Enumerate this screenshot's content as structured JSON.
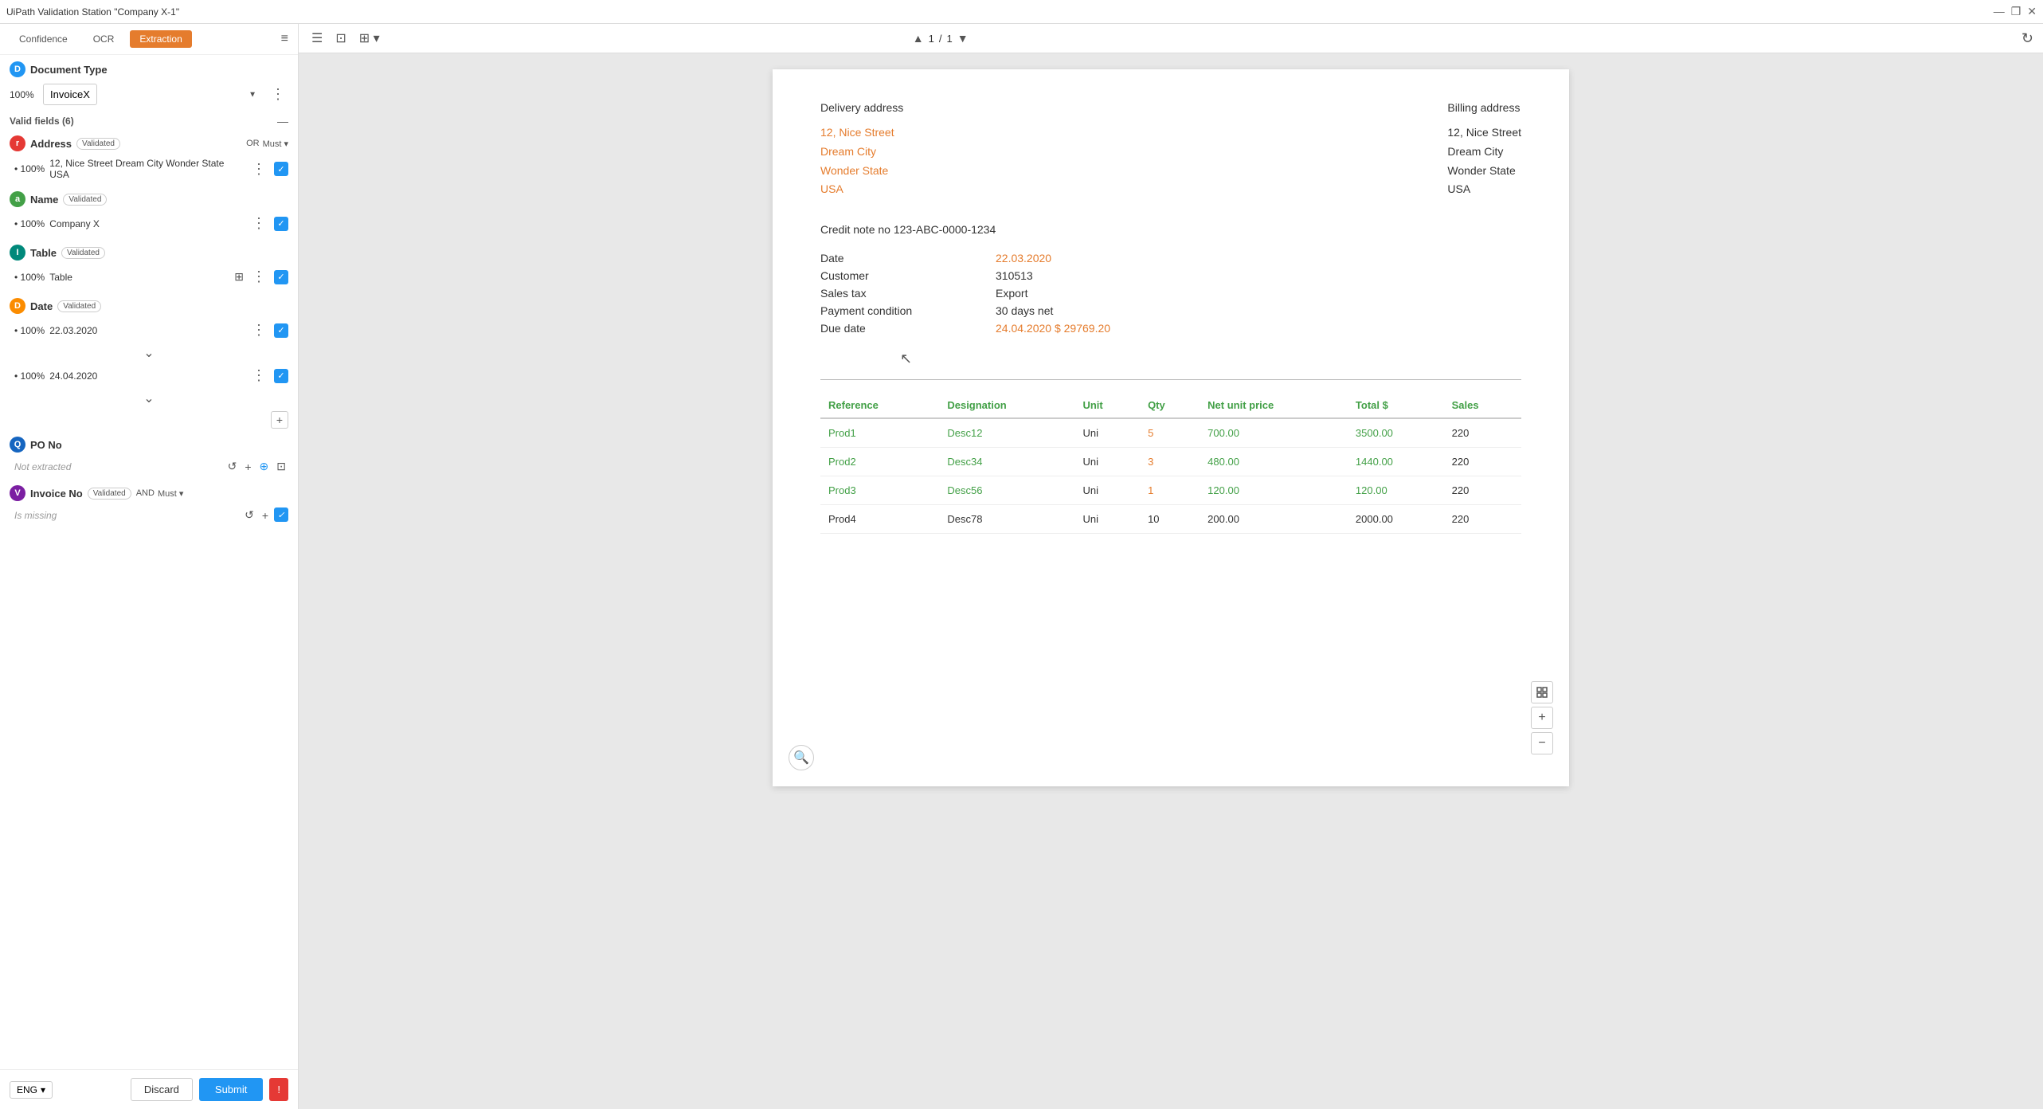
{
  "titlebar": {
    "title": "UiPath Validation Station \"Company X-1\"",
    "controls": [
      "—",
      "❐",
      "✕"
    ]
  },
  "tabs": {
    "confidence_label": "Confidence",
    "ocr_label": "OCR",
    "extraction_label": "Extraction",
    "active": "Extraction"
  },
  "toolbar_filter": "≡",
  "document_type": {
    "label": "Document Type",
    "confidence": "100%",
    "value": "InvoiceX",
    "more_icon": "⋮"
  },
  "valid_fields": {
    "label": "Valid fields (6)",
    "collapse_icon": "—"
  },
  "fields": [
    {
      "id": "address",
      "icon_letter": "r",
      "icon_class": "icon-red",
      "name": "Address",
      "badge": "Validated",
      "logic": "OR",
      "must": "Must",
      "confidence": "100%",
      "value": "12, Nice Street Dream City Wonder State USA",
      "checked": true
    },
    {
      "id": "name",
      "icon_letter": "a",
      "icon_class": "icon-green",
      "name": "Name",
      "badge": "Validated",
      "logic": "",
      "must": "",
      "confidence": "100%",
      "value": "Company X",
      "checked": true
    },
    {
      "id": "table",
      "icon_letter": "I",
      "icon_class": "icon-teal",
      "name": "Table",
      "badge": "Validated",
      "logic": "",
      "must": "",
      "confidence": "100%",
      "value": "Table",
      "is_table": true,
      "checked": true
    },
    {
      "id": "date",
      "icon_letter": "D",
      "icon_class": "icon-orange",
      "name": "Date",
      "badge": "Validated",
      "logic": "",
      "must": "",
      "confidence": "100%",
      "value": "22.03.2020",
      "checked": true,
      "has_expand": true,
      "extra_value": "24.04.2020",
      "extra_checked": true
    },
    {
      "id": "po-no",
      "icon_letter": "Q",
      "icon_class": "icon-navy",
      "name": "PO No",
      "badge": "",
      "logic": "",
      "must": "",
      "confidence": "",
      "value": "Not extracted",
      "is_not_extracted": true
    },
    {
      "id": "invoice-no",
      "icon_letter": "V",
      "icon_class": "icon-purple",
      "name": "Invoice No",
      "badge": "Validated",
      "logic": "AND",
      "must": "Must",
      "confidence": "",
      "value": "Is missing",
      "is_missing": true,
      "checked": true
    }
  ],
  "bottom_bar": {
    "lang": "ENG",
    "discard": "Discard",
    "submit": "Submit"
  },
  "doc_toolbar": {
    "page_current": "1",
    "page_total": "1"
  },
  "document": {
    "delivery_address_label": "Delivery address",
    "billing_address_label": "Billing address",
    "delivery_street": "12, Nice Street",
    "delivery_city": "Dream City",
    "delivery_state": "Wonder State",
    "delivery_country": "USA",
    "billing_street": "12, Nice Street",
    "billing_city": "Dream City",
    "billing_state": "Wonder State",
    "billing_country": "USA",
    "credit_note": "Credit note no 123-ABC-0000-1234",
    "info_rows": [
      {
        "label": "Date",
        "value": "22.03.2020",
        "highlight": true
      },
      {
        "label": "Customer",
        "value": "310513",
        "highlight": false
      },
      {
        "label": "Sales tax",
        "value": "Export",
        "highlight": false
      },
      {
        "label": "Payment condition",
        "value": "30 days net",
        "highlight": false
      },
      {
        "label": "Due date",
        "value": "24.04.2020 $ 29769.20",
        "highlight": true
      }
    ],
    "table_headers": [
      "Reference",
      "Designation",
      "Unit",
      "Qty",
      "Net unit price",
      "Total $",
      "Sales"
    ],
    "table_rows": [
      {
        "ref": "Prod1",
        "designation": "Desc12",
        "unit": "Uni",
        "qty": "5",
        "net_unit_price": "700.00",
        "total": "3500.00",
        "sales": "220",
        "highlight": true
      },
      {
        "ref": "Prod2",
        "designation": "Desc34",
        "unit": "Uni",
        "qty": "3",
        "net_unit_price": "480.00",
        "total": "1440.00",
        "sales": "220",
        "highlight": true
      },
      {
        "ref": "Prod3",
        "designation": "Desc56",
        "unit": "Uni",
        "qty": "1",
        "net_unit_price": "120.00",
        "total": "120.00",
        "sales": "220",
        "highlight": true
      },
      {
        "ref": "Prod4",
        "designation": "Desc78",
        "unit": "Uni",
        "qty": "10",
        "net_unit_price": "200.00",
        "total": "2000.00",
        "sales": "220",
        "highlight": false
      }
    ]
  }
}
